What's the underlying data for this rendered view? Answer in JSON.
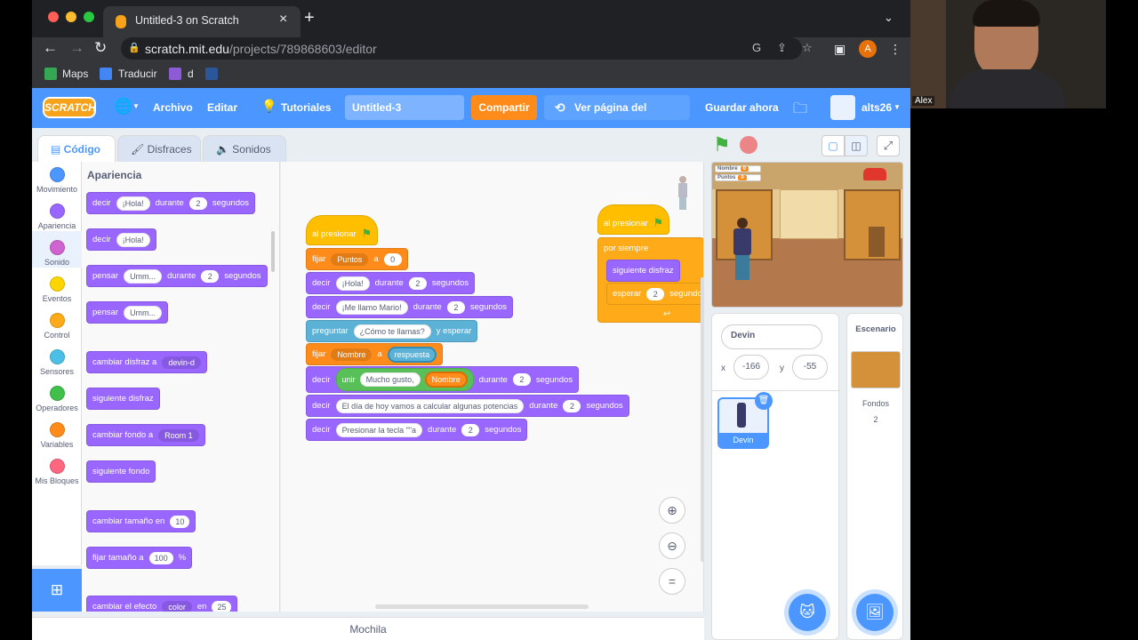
{
  "browser": {
    "tab_title": "Untitled-3 on Scratch",
    "url_host": "scratch.mit.edu",
    "url_path": "/projects/789868603/editor",
    "profile_initial": "A",
    "bookmarks": [
      "Maps",
      "Traducir",
      "d"
    ]
  },
  "menu": {
    "logo": "SCRATCH",
    "file": "Archivo",
    "edit": "Editar",
    "tutorials": "Tutoriales",
    "project_title": "Untitled-3",
    "share": "Compartir",
    "see_project": "Ver página del proyecto",
    "save": "Guardar ahora",
    "username": "alts26"
  },
  "tabs": {
    "code": "Código",
    "costumes": "Disfraces",
    "sounds": "Sonidos"
  },
  "categories": [
    {
      "label": "Movimiento",
      "color": "#4c97ff"
    },
    {
      "label": "Apariencia",
      "color": "#9966ff"
    },
    {
      "label": "Sonido",
      "color": "#cf63cf"
    },
    {
      "label": "Eventos",
      "color": "#ffd500"
    },
    {
      "label": "Control",
      "color": "#ffab19"
    },
    {
      "label": "Sensores",
      "color": "#4cbfe6"
    },
    {
      "label": "Operadores",
      "color": "#40bf4a"
    },
    {
      "label": "Variables",
      "color": "#ff8c1a"
    },
    {
      "label": "Mis Bloques",
      "color": "#ff6680"
    }
  ],
  "palette": {
    "heading": "Apariencia",
    "say_for": {
      "a": "decir",
      "b": "¡Hola!",
      "c": "durante",
      "d": "2",
      "e": "segundos"
    },
    "say": {
      "a": "decir",
      "b": "¡Hola!"
    },
    "think_for": {
      "a": "pensar",
      "b": "Umm...",
      "c": "durante",
      "d": "2",
      "e": "segundos"
    },
    "think": {
      "a": "pensar",
      "b": "Umm..."
    },
    "switch_costume": {
      "a": "cambiar disfraz a",
      "b": "devin-d"
    },
    "next_costume": "siguiente disfraz",
    "switch_backdrop": {
      "a": "cambiar fondo a",
      "b": "Room 1"
    },
    "next_backdrop": "siguiente fondo",
    "change_size": {
      "a": "cambiar tamaño en",
      "b": "10"
    },
    "set_size": {
      "a": "fijar tamaño a",
      "b": "100",
      "c": "%"
    },
    "change_effect": {
      "a": "cambiar el efecto",
      "b": "color",
      "c": "en",
      "d": "25"
    }
  },
  "script1": {
    "hat": "al presionar",
    "set1": {
      "a": "fijar",
      "b": "Puntos",
      "c": "a",
      "d": "0"
    },
    "say1": {
      "a": "decir",
      "b": "¡Hola!",
      "c": "durante",
      "d": "2",
      "e": "segundos"
    },
    "say2": {
      "a": "decir",
      "b": "¡Me llamo Mario!",
      "c": "durante",
      "d": "2",
      "e": "segundos"
    },
    "ask": {
      "a": "preguntar",
      "b": "¿Cómo te llamas?",
      "c": "y esperar"
    },
    "set2": {
      "a": "fijar",
      "b": "Nombre",
      "c": "a",
      "d": "respuesta"
    },
    "say3": {
      "a": "decir",
      "b": "unir",
      "c": "Mucho gusto,",
      "d": "Nombre",
      "e": "durante",
      "f": "2",
      "g": "segundos"
    },
    "say4": {
      "a": "decir",
      "b": "El día de hoy vamos a calcular algunas potencias",
      "c": "durante",
      "d": "2",
      "e": "segundos"
    },
    "say5": {
      "a": "decir",
      "b": "Presionar la tecla \"\"a",
      "c": "durante",
      "d": "2",
      "e": "segundos"
    }
  },
  "script2": {
    "hat": "al presionar",
    "forever": "por siempre",
    "next": "siguiente disfraz",
    "wait": {
      "a": "esperar",
      "b": "2",
      "c": "segundos"
    }
  },
  "stage": {
    "monitors": [
      {
        "name": "Nombre",
        "value": "0"
      },
      {
        "name": "Puntos",
        "value": "0"
      }
    ]
  },
  "sprite_info": {
    "name": "Devin",
    "x_label": "x",
    "x": "-166",
    "y_label": "y",
    "y": "-55",
    "sprite_label": "Devin"
  },
  "stage_pane": {
    "title": "Escenario",
    "backdrops_label": "Fondos",
    "backdrops_count": "2"
  },
  "backpack": "Mochila",
  "webcam": {
    "name": "Alex"
  }
}
